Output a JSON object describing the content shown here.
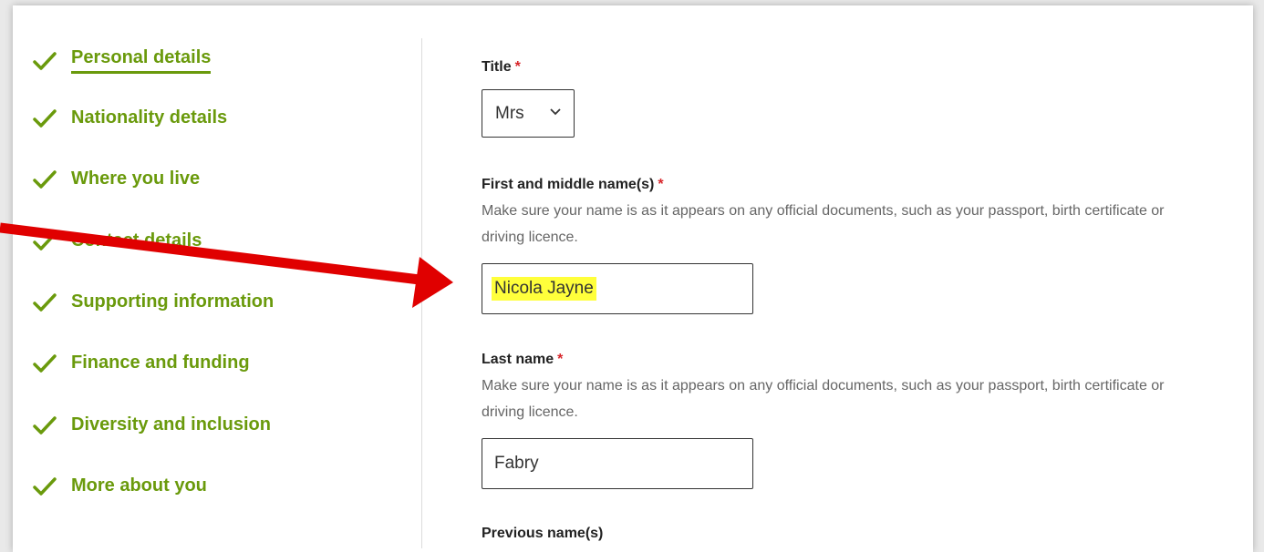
{
  "sidebar": {
    "items": [
      {
        "label": "Personal details",
        "status": "complete",
        "current": true
      },
      {
        "label": "Nationality details",
        "status": "complete"
      },
      {
        "label": "Where you live",
        "status": "complete"
      },
      {
        "label": "Contact details",
        "status": "complete"
      },
      {
        "label": "Supporting information",
        "status": "complete"
      },
      {
        "label": "Finance and funding",
        "status": "complete"
      },
      {
        "label": "Diversity and inclusion",
        "status": "complete"
      },
      {
        "label": "More about you",
        "status": "complete"
      }
    ]
  },
  "form": {
    "title": {
      "label": "Title",
      "required_mark": "*",
      "value": "Mrs"
    },
    "first_name": {
      "label": "First and middle name(s)",
      "required_mark": "*",
      "hint": "Make sure your name is as it appears on any official documents, such as your passport, birth certificate or driving licence.",
      "value": "Nicola Jayne"
    },
    "last_name": {
      "label": "Last name",
      "required_mark": "*",
      "hint": "Make sure your name is as it appears on any official documents, such as your passport, birth certificate or driving licence.",
      "value": "Fabry"
    },
    "previous_names": {
      "label": "Previous name(s)"
    }
  },
  "colors": {
    "accent_green": "#6a9a0c",
    "required_red": "#d8262b",
    "annotation_arrow": "#e00000",
    "highlight": "#ffff3b"
  },
  "icons": {
    "nav_status": "check-icon",
    "select": "chevron-down-icon",
    "annotation": "arrow-annotation"
  }
}
